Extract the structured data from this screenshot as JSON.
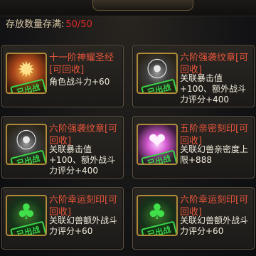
{
  "header": {
    "capacity_label": "存放数量存满:",
    "capacity_value": "50/50"
  },
  "items": [
    {
      "name": "十一阶神耀圣经[可回收]",
      "desc": "角色战斗力+60",
      "stamp": "已出战",
      "icon": "fire-book-icon",
      "icon_style": "fire"
    },
    {
      "name": "六阶强袭纹章[可回收]",
      "desc": "关联暴击值+100、额外战斗力评分+400",
      "stamp": "已出战",
      "icon": "emblem-icon",
      "icon_style": "badge"
    },
    {
      "name": "六阶强袭纹章[可回收]",
      "desc": "关联暴击值+100、额外战斗力评分+400",
      "stamp": "已出战",
      "icon": "emblem-icon",
      "icon_style": "badge"
    },
    {
      "name": "五阶亲密刻印[可回收]",
      "desc": "关联幻兽亲密度上限+888",
      "stamp": "已出战",
      "icon": "heart-seal-icon",
      "icon_style": "pink"
    },
    {
      "name": "六阶幸运刻印[可回收]",
      "desc": "关联幻兽额外战斗力评分+60",
      "stamp": "已出战",
      "icon": "clover-icon",
      "icon_style": "clover"
    },
    {
      "name": "六阶幸运刻印[可回收]",
      "desc": "关联幻兽额外战斗力评分+60",
      "stamp": "已出战",
      "icon": "clover-icon",
      "icon_style": "clover"
    }
  ],
  "colors": {
    "name_red": "#e8553a",
    "count_red": "#e02a2a",
    "stamp_green": "#3bd24a",
    "slot_gold": "#b08c3a"
  }
}
